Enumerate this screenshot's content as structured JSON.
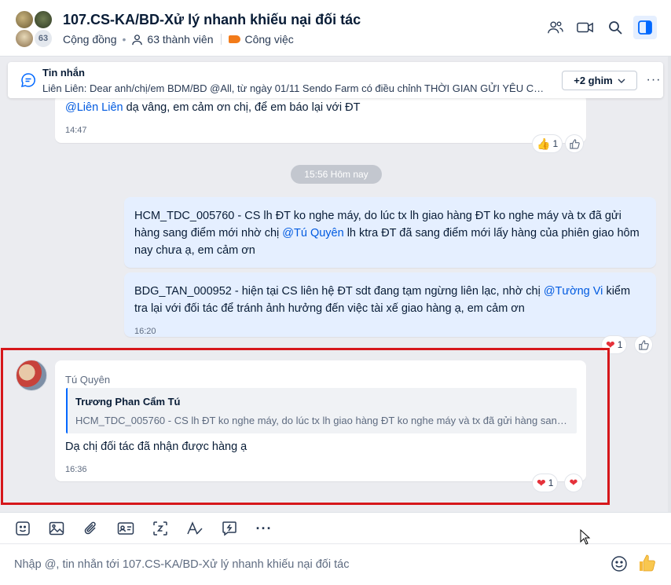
{
  "header": {
    "title": "107.CS-KA/BD-Xử lý nhanh khiếu nại đối tác",
    "type_label": "Cộng đồng",
    "members_label": "63 thành viên",
    "category_label": "Công việc",
    "avatar_count": "63"
  },
  "pinned": {
    "title": "Tin nhắn",
    "text": "Liên Liên: Dear anh/chị/em BDM/BD @All, từ ngày 01/11 Sendo Farm có điều chỉnh THỜI GIAN GỬI YÊU CẦU...",
    "more_button": "+2 ghim"
  },
  "messages": {
    "m1": {
      "mention": "@Liên Liên",
      "text": " dạ vâng, em cảm ơn chị, để em báo lại với ĐT",
      "time": "14:47",
      "reaction_count": "1"
    },
    "date_separator": "15:56 Hôm nay",
    "m2": {
      "part1": "HCM_TDC_005760 - CS lh ĐT ko nghe máy, do lúc tx lh giao hàng ĐT ko nghe máy và tx đã gửi hàng sang điểm mới nhờ chị ",
      "mention": "@Tú Quyên",
      "part2": " lh ktra ĐT đã sang điểm mới lấy hàng của phiên giao hôm nay chưa ạ, em cảm ơn"
    },
    "m3": {
      "part1": "BDG_TAN_000952 - hiện tại CS liên hệ ĐT sdt đang tạm ngừng liên lạc, nhờ chị ",
      "mention": "@Tường Vi",
      "part2": " kiểm tra lại với đối tác để tránh ảnh hưởng đến việc tài xế giao hàng ạ, em cảm ơn",
      "time": "16:20",
      "reaction_count": "1"
    },
    "m4": {
      "sender": "Tú Quyên",
      "quote_name": "Trương Phan Cẩm Tú",
      "quote_text": "HCM_TDC_005760 - CS lh ĐT ko nghe máy, do lúc tx lh giao hàng ĐT ko nghe máy và tx đã gửi hàng sang ...",
      "text": "Dạ chị đối tác đã nhận được hàng ạ",
      "time": "16:36",
      "reaction_count": "1"
    }
  },
  "composer": {
    "placeholder": "Nhập @, tin nhắn tới 107.CS-KA/BD-Xử lý nhanh khiếu nại đối tác"
  },
  "colors": {
    "accent": "#0068ff",
    "highlight_border": "#d6171b",
    "my_bubble": "#e5efff",
    "chat_bg": "#ebecf0"
  },
  "icons": [
    "add-member-icon",
    "video-call-icon",
    "search-icon",
    "sidebar-toggle-icon",
    "message-pin-icon",
    "sticker-icon",
    "image-icon",
    "attach-icon",
    "contact-card-icon",
    "screenshot-icon",
    "format-text-icon",
    "quick-message-icon",
    "more-icon",
    "emoji-icon",
    "like-icon"
  ]
}
